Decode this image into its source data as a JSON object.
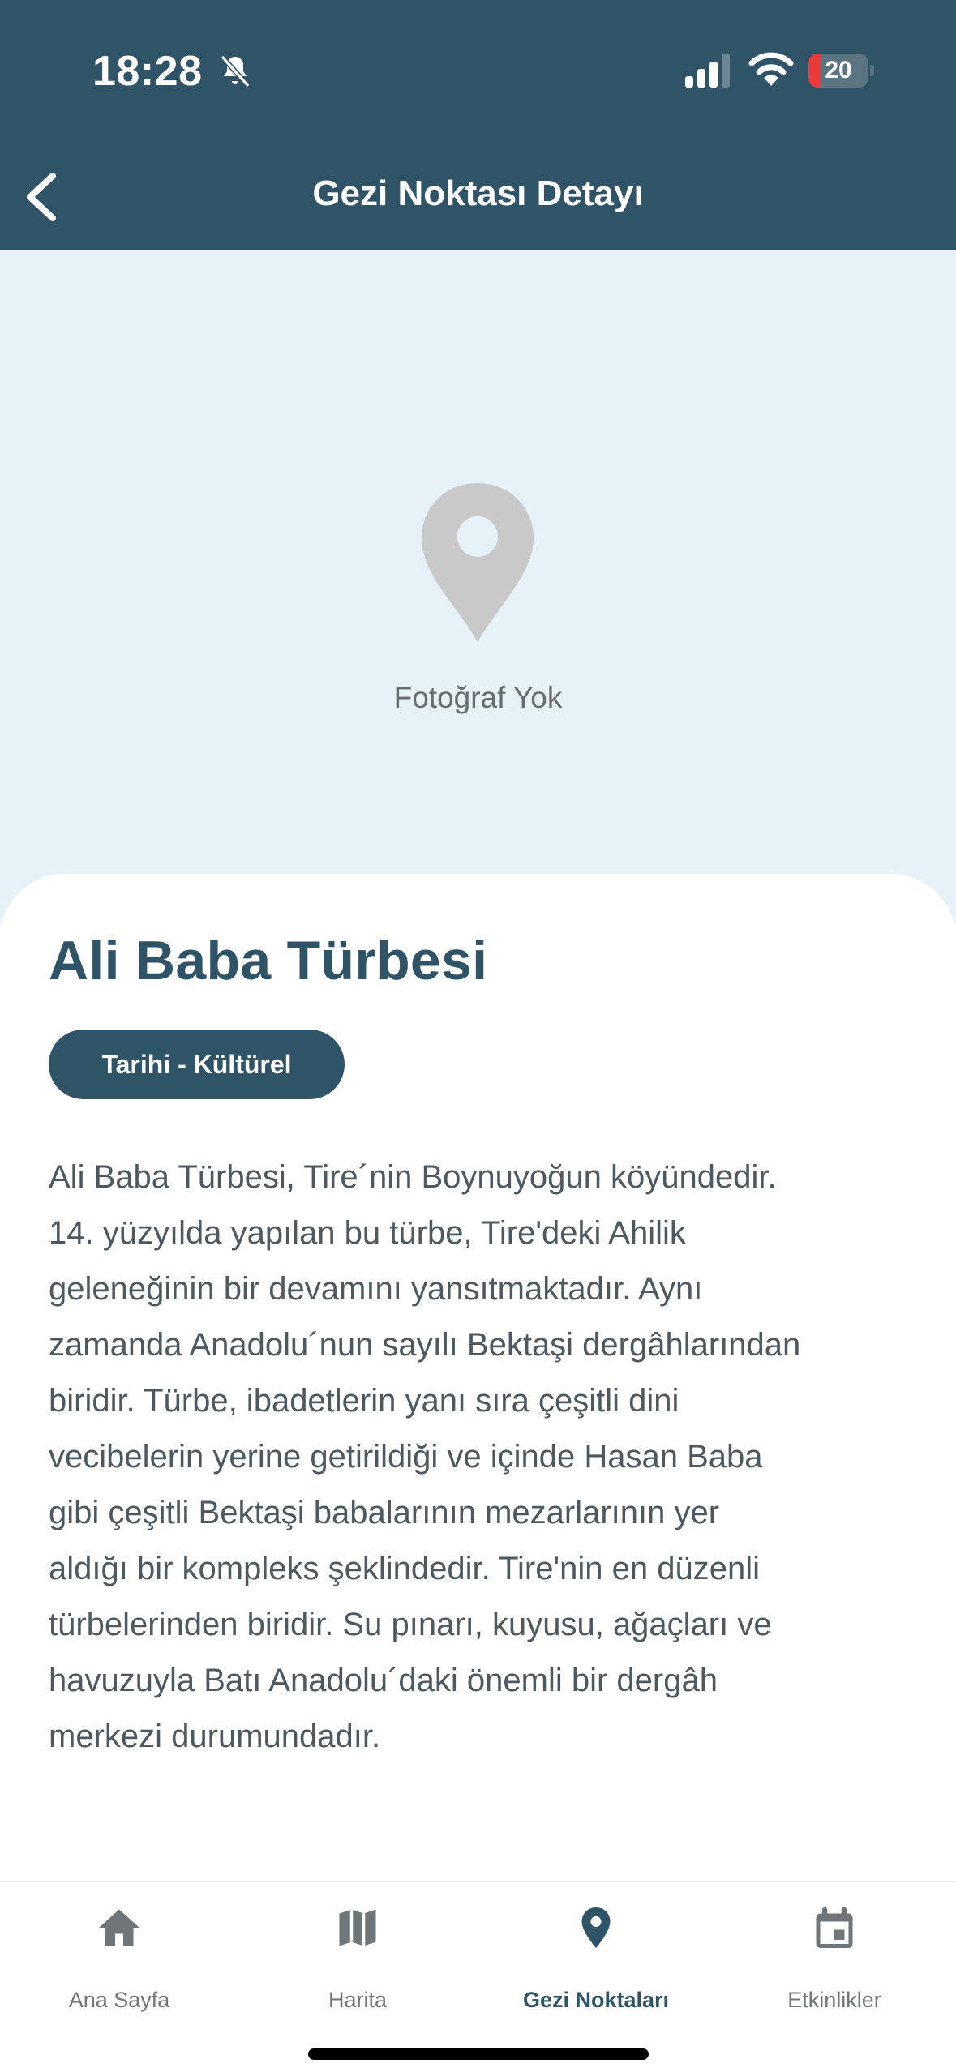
{
  "status_bar": {
    "time": "18:28",
    "battery_level": 20,
    "battery_text": "20",
    "icons": [
      "bell-slash-icon",
      "signal-icon",
      "wifi-icon",
      "battery-icon"
    ]
  },
  "header": {
    "title": "Gezi Noktası Detayı",
    "back_icon": "chevron-left-icon",
    "background_color": "#2f5367"
  },
  "photo": {
    "placeholder_icon": "map-pin-icon",
    "placeholder_label": "Fotoğraf Yok",
    "background_color": "#e7f2f8"
  },
  "place": {
    "title": "Ali Baba Türbesi",
    "category": "Tarihi - Kültürel",
    "description_lines": [
      "Ali Baba Türbesi, Tire´nin Boynuyoğun köyündedir.",
      "14. yüzyılda yapılan bu türbe, Tire'deki Ahilik",
      "geleneğinin bir devamını yansıtmaktadır. Aynı",
      "zamanda Anadolu´nun sayılı Bektaşi dergâhlarından",
      "biridir. Türbe, ibadetlerin yanı sıra çeşitli dini",
      "vecibelerin yerine getirildiği ve içinde Hasan Baba",
      "gibi çeşitli Bektaşi babalarının mezarlarının yer",
      "aldığı bir kompleks şeklindedir. Tire'nin en düzenli",
      "türbelerinden biridir. Su pınarı, kuyusu, ağaçları ve",
      "havuzuyla Batı Anadolu´daki önemli bir dergâh",
      "merkezi durumundadır."
    ]
  },
  "tab_bar": {
    "active_index": 2,
    "active_color": "#2f5367",
    "tabs": [
      {
        "label": "Ana Sayfa",
        "icon": "home-icon"
      },
      {
        "label": "Harita",
        "icon": "map-icon"
      },
      {
        "label": "Gezi Noktaları",
        "icon": "map-pin-icon"
      },
      {
        "label": "Etkinlikler",
        "icon": "calendar-icon"
      }
    ]
  }
}
